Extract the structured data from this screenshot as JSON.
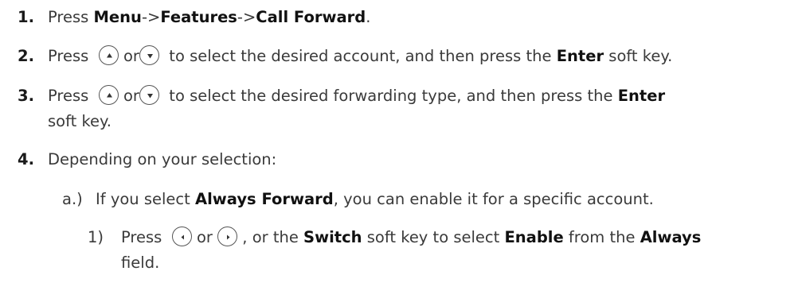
{
  "steps": [
    {
      "num": "1.",
      "pre": "Press ",
      "b1": "Menu",
      "sep1": "->",
      "b2": "Features",
      "sep2": "->",
      "b3": "Call Forward",
      "end": "."
    },
    {
      "num": "2.",
      "pre": "Press",
      "or": "or",
      "mid": "to select the desired account, and then press the ",
      "bold": "Enter",
      "end": " soft key."
    },
    {
      "num": "3.",
      "pre": "Press",
      "or": "or",
      "mid": "to select the desired forwarding type, and then press the ",
      "bold": "Enter",
      "cont": "soft key."
    },
    {
      "num": "4.",
      "text": "Depending on your selection:"
    }
  ],
  "sub_a": {
    "label": "a.)",
    "pre": "If you select ",
    "bold": "Always Forward",
    "end": ", you can enable it for a specific account."
  },
  "sub_1": {
    "label": "1)",
    "pre": "Press",
    "or": "or",
    "mid": ", or the ",
    "b1": "Switch",
    "mid2": " soft key to select ",
    "b2": "Enable",
    "mid3": " from the ",
    "b3": "Always",
    "cont": "field."
  },
  "icons": {
    "up": "up-key-icon",
    "down": "down-key-icon",
    "left": "left-key-icon",
    "right": "right-key-icon"
  }
}
